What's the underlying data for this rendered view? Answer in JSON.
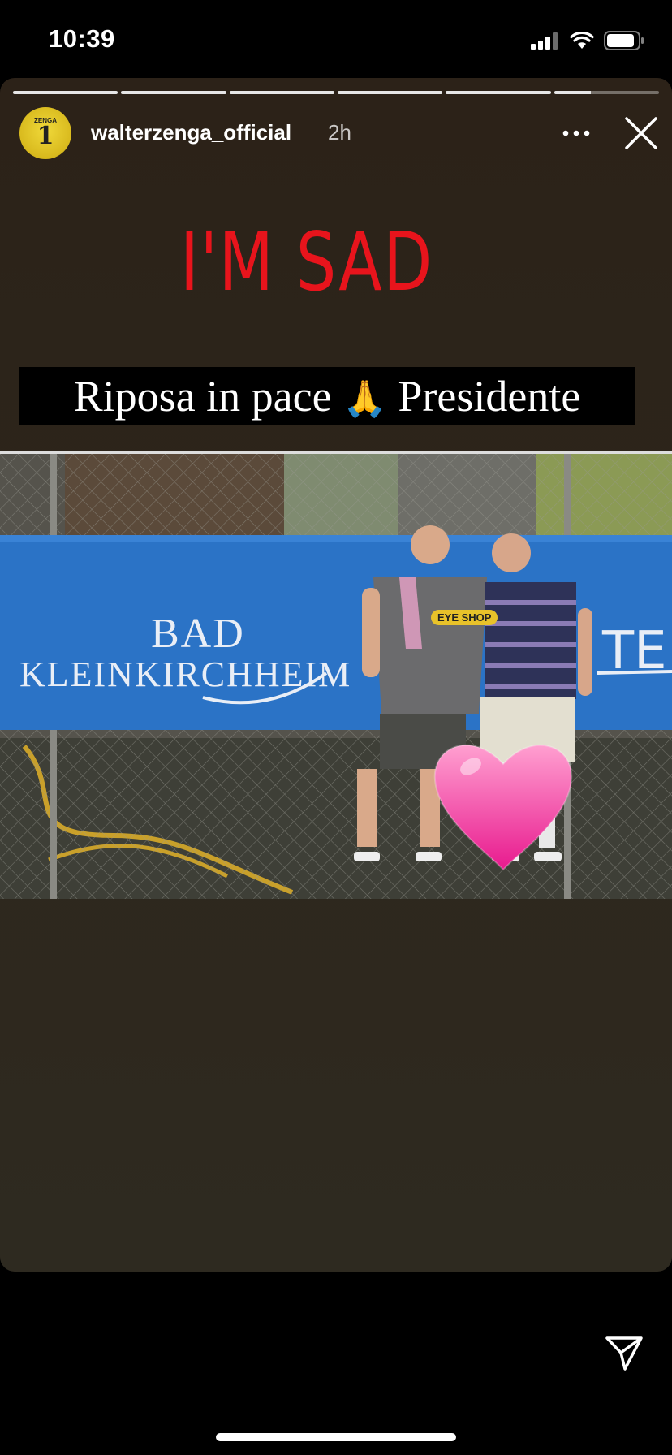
{
  "status_bar": {
    "time": "10:39"
  },
  "story": {
    "progress": {
      "segments": 6,
      "current_segment_progress": 0.35
    },
    "username": "walterzenga_official",
    "posted": "2h",
    "avatar": {
      "name": "ZENGA",
      "number": "1"
    },
    "sticker_text": "I'M SAD",
    "caption": {
      "before": "Riposa in pace",
      "emoji": "🙏",
      "after": "Presidente"
    },
    "photo": {
      "banner_line1": "BAD",
      "banner_line2": "KLEINKIRCHHEIM",
      "banner_partial": "TE",
      "sponsor": "EYE SHOP"
    }
  },
  "colors": {
    "background": "#2c2218",
    "sticker": "#e8141c",
    "heart": "#ff5fae"
  },
  "icons": [
    "signal-icon",
    "wifi-icon",
    "battery-icon",
    "more-icon",
    "close-icon",
    "send-icon",
    "heart-sticker"
  ]
}
